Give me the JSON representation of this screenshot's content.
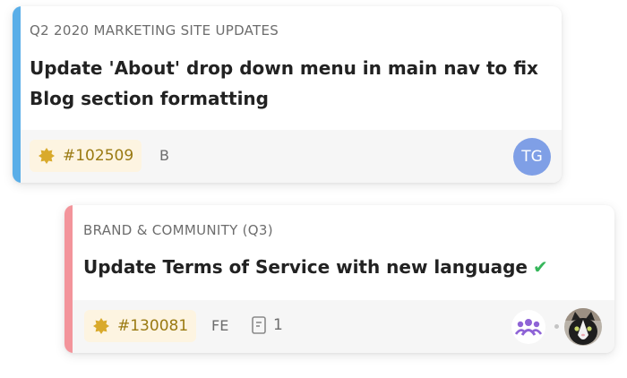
{
  "cards": [
    {
      "project": "Q2 2020 MARKETING SITE UPDATES",
      "title_line1": "Update 'About' drop down menu in main nav to fix",
      "title_line2": "Blog section formatting",
      "ticket": "#102509",
      "tag": "B",
      "assignee_initials": "TG",
      "accent_color": "#5aaee8"
    },
    {
      "project": "BRAND & COMMUNITY (Q3)",
      "title": "Update Terms of Service with new language",
      "status_icon": "checkmark-icon",
      "ticket": "#130081",
      "tag": "FE",
      "doc_count": "1",
      "accent_color": "#f3949b"
    }
  ],
  "colors": {
    "ticket_badge_bg": "#fdf4e1",
    "ticket_text": "#9a7a12",
    "avatar_bg": "#7f9fe6",
    "team_icon": "#8e63d6",
    "check": "#35b65a"
  }
}
